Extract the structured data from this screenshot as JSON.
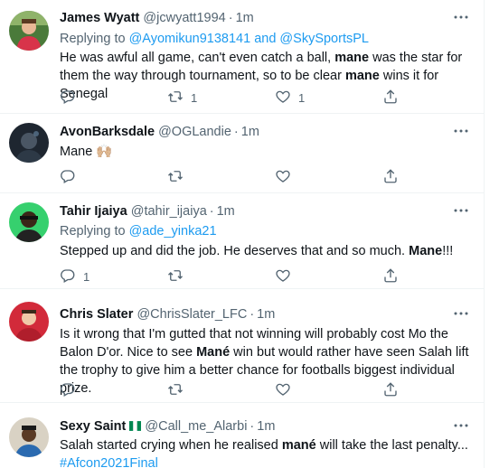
{
  "tweets": [
    {
      "name": "James Wyatt",
      "handle": "@jcwyatt1994",
      "dot": "·",
      "time": "1m",
      "reply_prefix": "Replying to",
      "reply_handle_1": "@Ayomikun9138141",
      "reply_and": "and",
      "reply_handle_2": "@SkySportsPL",
      "text_1": "He was awful all game, can't even catch a ball, ",
      "text_2": "mane",
      "text_3": " was the star for them the way through tournament, so to be clear ",
      "text_4": "mane",
      "text_5": " wins it for Senegal",
      "reply_count": "",
      "retweet_count": "1",
      "like_count": "1"
    },
    {
      "name": "AvonBarksdale",
      "handle": "@OGLandie",
      "dot": "·",
      "time": "1m",
      "text_1": "Mane ",
      "emoji": "🙌🏼",
      "reply_count": "",
      "retweet_count": "",
      "like_count": ""
    },
    {
      "name": "Tahir Ijaiya",
      "handle": "@tahir_ijaiya",
      "dot": "·",
      "time": "1m",
      "reply_prefix": "Replying to",
      "reply_handle_1": "@ade_yinka21",
      "text_1": "Stepped up and did the job. He deserves that and so much. ",
      "text_2": "Mane",
      "text_3": "!!!",
      "reply_count": "1",
      "retweet_count": "",
      "like_count": ""
    },
    {
      "name": "Chris Slater",
      "handle": "@ChrisSlater_LFC",
      "dot": "·",
      "time": "1m",
      "text_1": "Is it wrong that I'm gutted that not winning will probably cost Mo the Balon D'or. Nice to see ",
      "text_2": "Mané",
      "text_3": " win but would rather have seen Salah lift the trophy to give him a better chance for footballs biggest individual prize.",
      "reply_count": "",
      "retweet_count": "",
      "like_count": ""
    },
    {
      "name": "Sexy Saint",
      "handle": "@Call_me_Alarbi",
      "dot": "·",
      "time": "1m",
      "text_1": "Salah started crying when he realised ",
      "text_2": "mané",
      "text_3": " will take the last penalty...",
      "hashtag": "#Afcon2021Final"
    }
  ],
  "icons": {
    "more": "more-icon",
    "reply": "reply-icon",
    "retweet": "retweet-icon",
    "like": "like-icon",
    "share": "share-icon"
  },
  "colors": {
    "link": "#1d9bf0",
    "secondary_text": "#536471",
    "primary_text": "#0f1419",
    "divider": "#eff3f4"
  }
}
